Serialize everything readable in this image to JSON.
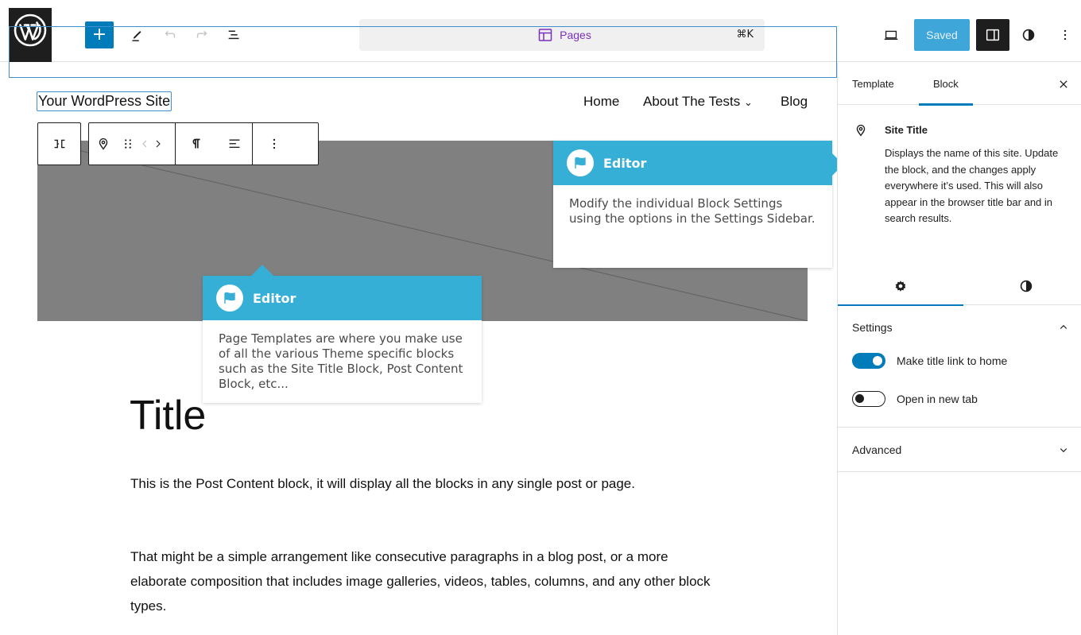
{
  "topbar": {
    "logo_icon": "wordpress-logo-icon",
    "add_label": "+",
    "document_bar": {
      "label": "Pages",
      "shortcut": "⌘K",
      "icon": "page-layout-icon"
    },
    "saved_label": "Saved",
    "colors": {
      "accent": "#007cba",
      "document_label": "#7b2fbe",
      "saved_bg": "#3ea6d9"
    }
  },
  "canvas": {
    "site_title": "Your WordPress Site",
    "nav": {
      "items": [
        "Home",
        "About The Tests",
        "Blog"
      ],
      "dropdown_glyph": "⌄"
    },
    "post_title": "Title",
    "paragraphs": [
      "This is the Post Content block, it will display all the blocks in any single post or page.",
      "That might be a simple arrangement like consecutive paragraphs in a blog post, or a more elaborate composition that includes image galleries, videos, tables, columns, and any other block types."
    ]
  },
  "tours": [
    {
      "title": "Editor",
      "body": "Modify the individual Block Settings using the options in the Settings Sidebar."
    },
    {
      "title": "Editor",
      "body": "Page Templates are where you make use of all the various Theme specific blocks such as the Site Title Block, Post Content Block, etc..."
    }
  ],
  "sidebar": {
    "tabs": [
      "Template",
      "Block"
    ],
    "active_tab": "Block",
    "block_card": {
      "title": "Site Title",
      "description": "Displays the name of this site. Update the block, and the changes apply everywhere it’s used. This will also appear in the browser title bar and in search results."
    },
    "settings_panel": {
      "title": "Settings",
      "toggles": [
        {
          "label": "Make title link to home",
          "on": true
        },
        {
          "label": "Open in new tab",
          "on": false
        }
      ]
    },
    "advanced_panel": {
      "title": "Advanced"
    }
  }
}
